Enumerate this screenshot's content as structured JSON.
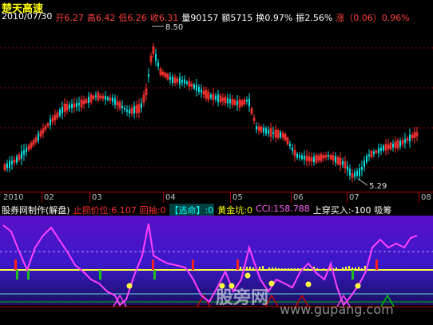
{
  "stock": {
    "name": "楚天高速"
  },
  "quote": {
    "date": "2010/07/30",
    "open": "开6.27",
    "high": "高6.42",
    "low": "低6.26",
    "close": "收6.31",
    "volume": "量90157",
    "amount": "额5715",
    "turnover": "换0.97%",
    "amplitude": "振2.56%",
    "change": "涨（0.06）0.96%"
  },
  "main_chart": {
    "high_label": "8.50",
    "low_label": "5.29",
    "colors": {
      "up": "#ff3232",
      "down": "#00e0e0",
      "grid": "#a00000"
    }
  },
  "time_axis": {
    "labels": [
      "2010",
      "02",
      "03",
      "04",
      "05",
      "06",
      "07",
      "08"
    ]
  },
  "indicator": {
    "title": "股券网制作(解盘)",
    "stop_loss": "止损价位:6.107",
    "pullback": "回抽:0",
    "escape_tag": "【逃命】:0",
    "golden_pit": "黄金坑:0",
    "cci": "CCI:158.788",
    "buy_cross": "上穿买入:-100",
    "absorb": "吸筹"
  },
  "watermark": {
    "text": "股旁网",
    "url": "www.gupang.com"
  },
  "chart_data": [
    {
      "type": "candlestick",
      "title": "楚天高速",
      "x_labels": [
        "2010",
        "02",
        "03",
        "04",
        "05",
        "06",
        "07",
        "08"
      ],
      "annotations": [
        {
          "label": "8.50",
          "type": "max"
        },
        {
          "label": "5.29",
          "type": "min"
        }
      ],
      "ylim": [
        5.29,
        8.5
      ]
    },
    {
      "type": "line",
      "title": "股券网制作(解盘)",
      "series": [
        {
          "name": "CCI",
          "last": 158.788
        }
      ]
    }
  ]
}
